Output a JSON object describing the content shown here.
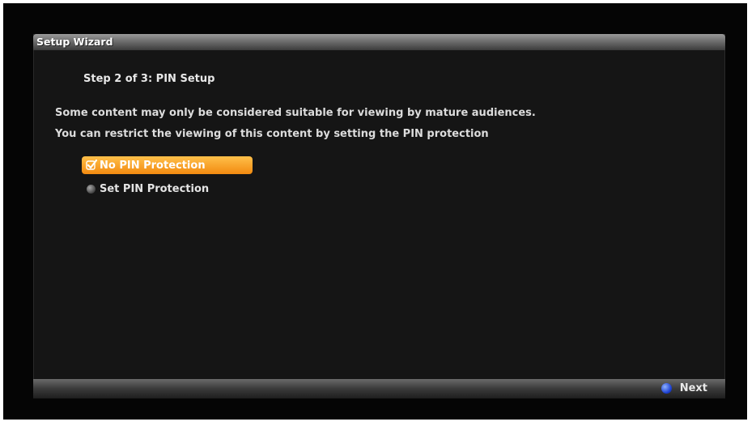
{
  "window": {
    "title": "Setup Wizard"
  },
  "wizard": {
    "step_title": "Step 2 of 3: PIN Setup",
    "description_line1": "Some content may only be considered suitable for viewing by mature audiences.",
    "description_line2": "You can restrict the viewing of this content by setting the PIN protection"
  },
  "options": [
    {
      "label": "No PIN Protection",
      "selected": true,
      "icon": "checkbox-checked-icon"
    },
    {
      "label": "Set PIN Protection",
      "selected": false,
      "icon": "radio-unselected-icon"
    }
  ],
  "footer": {
    "next_label": "Next",
    "next_icon": "blue-button-icon"
  },
  "colors": {
    "highlight": "#f6a020",
    "next_button": "#1b3fd1"
  }
}
